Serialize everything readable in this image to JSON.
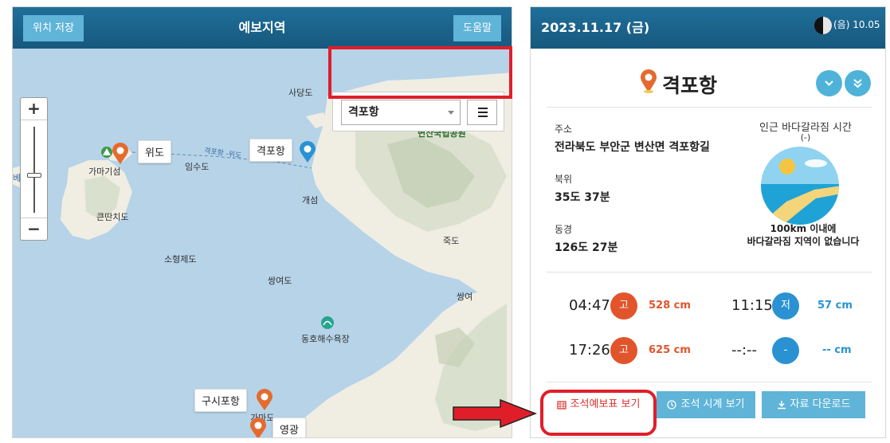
{
  "map_panel": {
    "save_location_label": "위치 저장",
    "title": "예보지역",
    "help_label": "도움말",
    "zoom_in": "+",
    "zoom_out": "−",
    "station_select_value": "격포항",
    "labels": {
      "sadangdo": "사당도",
      "byeonsan_park": "변산국립공원",
      "wido": "위도",
      "gamagiseum": "가마기섬",
      "imsudo": "임수도",
      "route": "격포항 -위도",
      "gyeokpo": "격포항",
      "gaeseom": "개섬",
      "keunttanchido": "큰딴치도",
      "sohyeongjedo": "소형제도",
      "ssangyeodo": "쌍여도",
      "jukdo": "죽도",
      "ssangyeo": "쌍여",
      "donghoe_beach": "동호해수욕장",
      "gusipo": "구시포항",
      "gamado": "가마도",
      "yeonggwang": "영광",
      "edge_be": "베"
    }
  },
  "info_panel": {
    "date": "2023.11.17 (금)",
    "lunar_date": "(음) 10.05",
    "station_name": "격포항",
    "address_label": "주소",
    "address_value": "전라북도 부안군 변산면 격포항길",
    "lat_label": "북위",
    "lat_value": "35도 37분",
    "lon_label": "동경",
    "lon_value": "126도 27분",
    "sea_parting_title": "인근 바다갈라짐 시간",
    "sea_parting_value": "(-)",
    "sea_parting_note_line1": "100km 이내에",
    "sea_parting_note_line2": "바다갈라짐 지역이 없습니다",
    "tides": [
      {
        "time": "04:47",
        "type": "고",
        "value": "528 cm"
      },
      {
        "time": "11:15",
        "type": "저",
        "value": "57 cm"
      },
      {
        "time": "17:26",
        "type": "고",
        "value": "625 cm"
      },
      {
        "time": "--:--",
        "type": "-",
        "value": "-- cm"
      }
    ],
    "actions": {
      "tide_table": "조석예보표 보기",
      "tide_clock": "조석 시계 보기",
      "download": "자료 다운로드"
    }
  },
  "colors": {
    "header": "#1f6f9a",
    "button": "#5fb4d8",
    "high_tide": "#e2542b",
    "low_tide": "#2a92d3",
    "highlight": "#e01e2a"
  }
}
